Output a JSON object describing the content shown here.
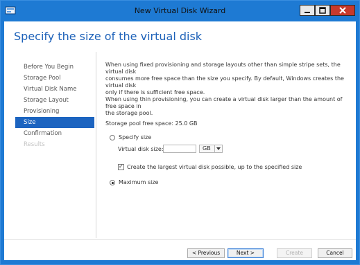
{
  "window": {
    "title": "New Virtual Disk Wizard",
    "controls": {
      "minimize": "minimize",
      "maximize": "maximize",
      "close": "close"
    }
  },
  "page": {
    "title": "Specify the size of the virtual disk"
  },
  "nav": {
    "items": [
      {
        "label": "Before You Begin",
        "state": "normal"
      },
      {
        "label": "Storage Pool",
        "state": "normal"
      },
      {
        "label": "Virtual Disk Name",
        "state": "normal"
      },
      {
        "label": "Storage Layout",
        "state": "normal"
      },
      {
        "label": "Provisioning",
        "state": "normal"
      },
      {
        "label": "Size",
        "state": "active"
      },
      {
        "label": "Confirmation",
        "state": "normal"
      },
      {
        "label": "Results",
        "state": "disabled"
      }
    ]
  },
  "content": {
    "desc_lines": [
      "When using fixed provisioning and storage layouts other than simple stripe sets, the virtual disk",
      "consumes more free space than the size you specify. By default, Windows creates the virtual disk",
      "only if there is sufficient free space.",
      "When using thin provisioning, you can create a virtual disk larger than the amount of free space in",
      "the storage pool."
    ],
    "pool_free_space": "Storage pool free space:  25.0 GB",
    "specify_size": {
      "label": "Specify size",
      "selected": false,
      "size_label": "Virtual disk size:",
      "size_value": "",
      "unit": "GB"
    },
    "create_largest": {
      "label": "Create the largest virtual disk possible, up to the specified size",
      "checked": true
    },
    "maximum_size": {
      "label": "Maximum size",
      "selected": true
    }
  },
  "buttons": {
    "previous": "< Previous",
    "next": "Next >",
    "create": "Create",
    "cancel": "Cancel"
  },
  "colors": {
    "titlebar": "#1e7ad3",
    "accent": "#1c64c0",
    "page_title": "#1e62b9",
    "close": "#c7392b"
  }
}
